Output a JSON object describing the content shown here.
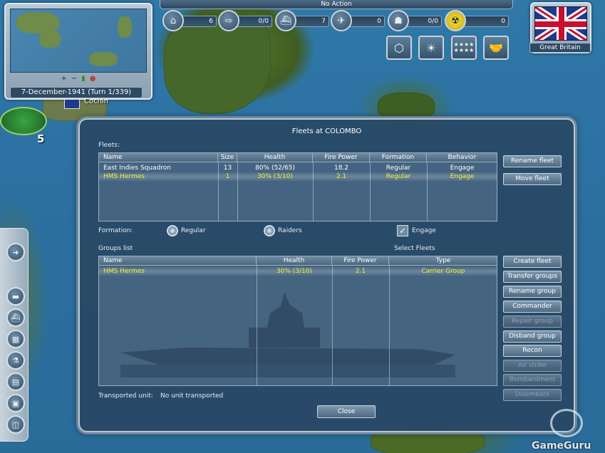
{
  "topbar": {
    "action": "No Action",
    "stats": [
      {
        "icon": "factory-icon",
        "value": "6"
      },
      {
        "icon": "arrow-icon",
        "value": "0/0"
      },
      {
        "icon": "ship-icon",
        "value": "7"
      },
      {
        "icon": "plane-icon",
        "value": "0"
      },
      {
        "icon": "soldier-icon",
        "value": "0/0"
      },
      {
        "icon": "nuclear-icon",
        "value": "0"
      }
    ],
    "square_buttons": [
      "hexagon-icon",
      "weather-icon",
      "stars-icon",
      "handshake-icon"
    ]
  },
  "minimap": {
    "date": "7-December-1941 (Turn 1/339)"
  },
  "nation": {
    "name": "Great Britain"
  },
  "city": {
    "name": "Cochin",
    "count": "5"
  },
  "dialog": {
    "title": "Fleets at COLOMBO",
    "fleets_label": "Fleets:",
    "fleet_columns": [
      "Name",
      "Size",
      "Health",
      "Fire Power",
      "Formation",
      "Behavior"
    ],
    "fleets": [
      {
        "name": "East Indies Squadron",
        "size": "13",
        "health": "80% (52/65)",
        "fire_power": "18.2",
        "formation": "Regular",
        "behavior": "Engage",
        "selected": false
      },
      {
        "name": "HMS Hermes",
        "size": "1",
        "health": "30% (3/10)",
        "fire_power": "2.1",
        "formation": "Regular",
        "behavior": "Engage",
        "selected": true
      }
    ],
    "fleet_buttons": [
      "Rename fleet",
      "Move fleet"
    ],
    "formation_label": "Formation:",
    "formation_options": [
      "Regular",
      "Raiders"
    ],
    "engage_label": "Engage",
    "groups_label": "Groups list",
    "select_fleets_label": "Select Fleets",
    "group_columns": [
      "Name",
      "Health",
      "Fire Power",
      "Type"
    ],
    "groups": [
      {
        "name": "HMS Hermes",
        "health": "30% (3/10)",
        "fire_power": "2.1",
        "type": "Carrier Group",
        "selected": true
      }
    ],
    "group_buttons": [
      {
        "label": "Create fleet",
        "enabled": true
      },
      {
        "label": "Transfer groups",
        "enabled": true
      },
      {
        "label": "Rename group",
        "enabled": true
      },
      {
        "label": "Commander",
        "enabled": true
      },
      {
        "label": "Repair group",
        "enabled": false
      },
      {
        "label": "Disband group",
        "enabled": true
      },
      {
        "label": "Recon",
        "enabled": true
      },
      {
        "label": "Air strike",
        "enabled": false
      },
      {
        "label": "Bombardment",
        "enabled": false
      },
      {
        "label": "Disembark",
        "enabled": false
      }
    ],
    "transported_label": "Transported unit:",
    "transported_value": "No unit transported",
    "close_label": "Close"
  },
  "watermark": "GameGuru"
}
